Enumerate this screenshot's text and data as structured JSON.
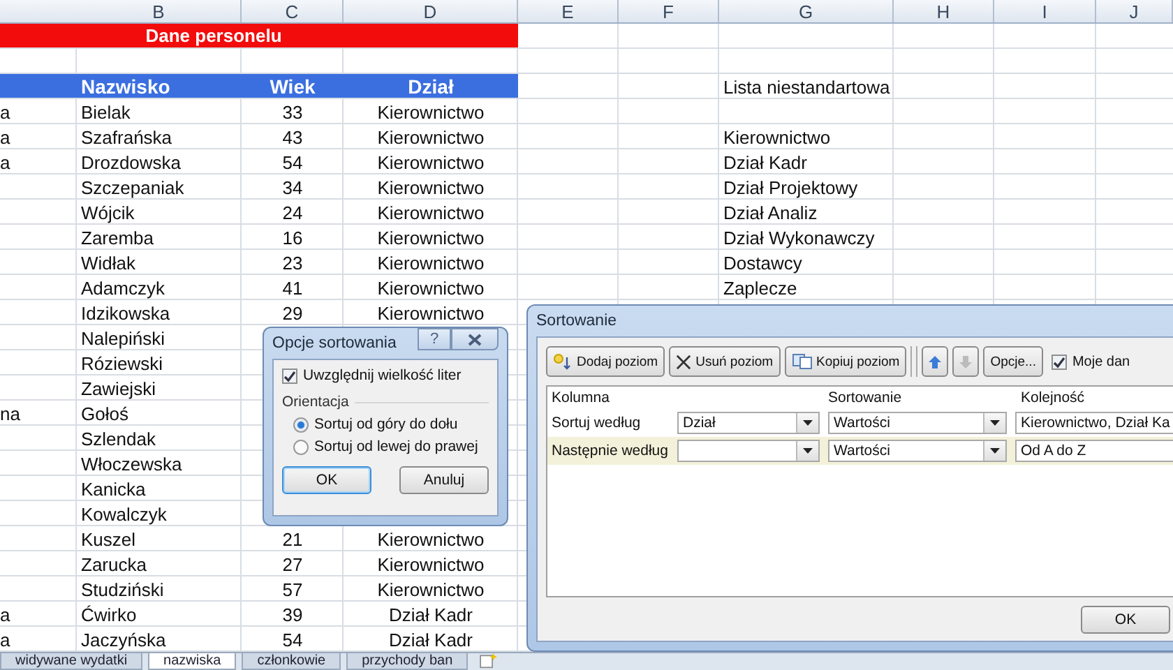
{
  "columns": [
    "B",
    "C",
    "D",
    "E",
    "F",
    "G",
    "H",
    "I",
    "J"
  ],
  "title": "Dane personelu",
  "headers": [
    "Nazwisko",
    "Wiek",
    "Dział"
  ],
  "rows": [
    {
      "col_a": "a",
      "nazwisko": "Bielak",
      "wiek": "33",
      "dzial": "Kierownictwo"
    },
    {
      "col_a": "a",
      "nazwisko": "Szafrańska",
      "wiek": "43",
      "dzial": "Kierownictwo"
    },
    {
      "col_a": "a",
      "nazwisko": "Drozdowska",
      "wiek": "54",
      "dzial": "Kierownictwo"
    },
    {
      "nazwisko": "Szczepaniak",
      "wiek": "34",
      "dzial": "Kierownictwo"
    },
    {
      "nazwisko": "Wójcik",
      "wiek": "24",
      "dzial": "Kierownictwo"
    },
    {
      "nazwisko": "Zaremba",
      "wiek": "16",
      "dzial": "Kierownictwo"
    },
    {
      "nazwisko": "Widłak",
      "wiek": "23",
      "dzial": "Kierownictwo"
    },
    {
      "nazwisko": "Adamczyk",
      "wiek": "41",
      "dzial": "Kierownictwo"
    },
    {
      "nazwisko": "Idzikowska",
      "wiek": "29",
      "dzial": "Kierownictwo"
    },
    {
      "nazwisko": "Nalepiński"
    },
    {
      "nazwisko": "Róziewski"
    },
    {
      "nazwisko": "Zawiejski"
    },
    {
      "col_a": "na",
      "nazwisko": "Gołoś"
    },
    {
      "nazwisko": "Szlendak"
    },
    {
      "nazwisko": "Włoczewska"
    },
    {
      "nazwisko": "Kanicka"
    },
    {
      "nazwisko": "Kowalczyk"
    },
    {
      "nazwisko": "Kuszel",
      "wiek": "21",
      "dzial": "Kierownictwo"
    },
    {
      "nazwisko": "Zarucka",
      "wiek": "27",
      "dzial": "Kierownictwo"
    },
    {
      "nazwisko": "Studziński",
      "wiek": "57",
      "dzial": "Kierownictwo"
    },
    {
      "col_a": "a",
      "nazwisko": "Ćwirko",
      "wiek": "39",
      "dzial": "Dział Kadr"
    },
    {
      "col_a": "a",
      "nazwisko": "Jaczyńska",
      "wiek": "54",
      "dzial": "Dział Kadr"
    }
  ],
  "custom_list": {
    "title": "Lista niestandartowa",
    "items": [
      "Kierownictwo",
      "Dział Kadr",
      "Dział Projektowy",
      "Dział Analiz",
      "Dział Wykonawczy",
      "Dostawcy",
      "Zaplecze"
    ]
  },
  "sheet_tabs": [
    {
      "label": "widywane wydatki",
      "selected": false
    },
    {
      "label": "nazwiska",
      "selected": true
    },
    {
      "label": "członkowie",
      "selected": false
    },
    {
      "label": "przychody ban",
      "selected": false
    }
  ],
  "options_dialog": {
    "title": "Opcje sortowania",
    "help": "?",
    "case_sensitive": {
      "label": "Uwzględnij wielkość liter",
      "checked": true
    },
    "group": "Orientacja",
    "orientations": [
      {
        "label": "Sortuj od góry do dołu",
        "selected": true
      },
      {
        "label": "Sortuj od lewej do prawej",
        "selected": false
      }
    ],
    "buttons": [
      "OK",
      "Anuluj"
    ]
  },
  "sort_dialog": {
    "title": "Sortowanie",
    "toolbar": [
      {
        "kind": "add",
        "label": "Dodaj poziom",
        "disabled": false
      },
      {
        "kind": "delete",
        "label": "Usuń poziom",
        "disabled": false
      },
      {
        "kind": "copy",
        "label": "Kopiuj poziom",
        "disabled": false
      },
      {
        "kind": "up",
        "disabled": false
      },
      {
        "kind": "down",
        "disabled": true
      },
      {
        "kind": "text",
        "label": "Opcje...",
        "disabled": false
      }
    ],
    "headers_checkbox": {
      "label": "Moje dan",
      "checked": true
    },
    "columns": [
      "Kolumna",
      "Sortowanie",
      "Kolejność"
    ],
    "levels": [
      {
        "label": "Sortuj według",
        "column": "Dział",
        "sort_on": "Wartości",
        "order": "Kierownictwo, Dział Ka",
        "selected": false
      },
      {
        "label": "Następnie według",
        "sort_on": "Wartości",
        "order": "Od A do Z",
        "selected": true
      }
    ],
    "button": "OK"
  }
}
